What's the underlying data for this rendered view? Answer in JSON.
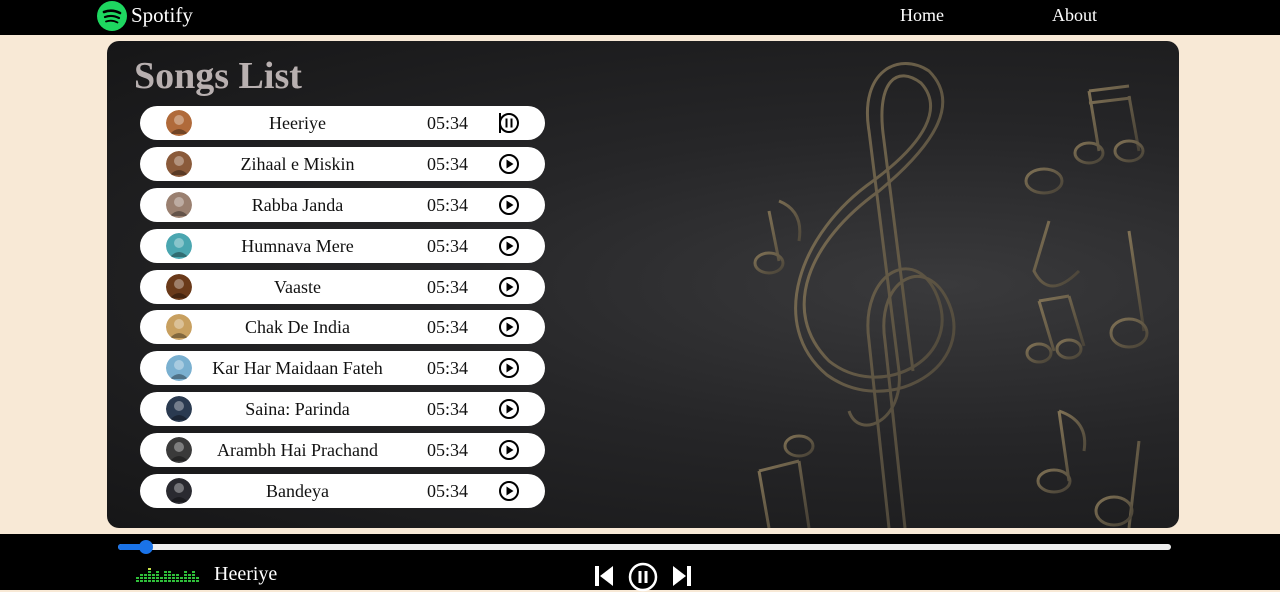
{
  "nav": {
    "brand": "Spotify",
    "links": [
      "Home",
      "About"
    ],
    "brand_color": "#1ed760"
  },
  "main": {
    "title": "Songs List",
    "songs": [
      {
        "name": "Heeriye",
        "duration": "05:34",
        "state": "pause-icon",
        "cover_color": "#b06a3a"
      },
      {
        "name": "Zihaal e Miskin",
        "duration": "05:34",
        "state": "play-icon",
        "cover_color": "#8a5a3a"
      },
      {
        "name": "Rabba Janda",
        "duration": "05:34",
        "state": "play-icon",
        "cover_color": "#9a8070"
      },
      {
        "name": "Humnava Mere",
        "duration": "05:34",
        "state": "play-icon",
        "cover_color": "#4aa6b0"
      },
      {
        "name": "Vaaste",
        "duration": "05:34",
        "state": "play-icon",
        "cover_color": "#6a3a1a"
      },
      {
        "name": "Chak De India",
        "duration": "05:34",
        "state": "play-icon",
        "cover_color": "#c8a060"
      },
      {
        "name": "Kar Har Maidaan Fateh",
        "duration": "05:34",
        "state": "play-icon",
        "cover_color": "#7ab0d0"
      },
      {
        "name": "Saina: Parinda",
        "duration": "05:34",
        "state": "play-icon",
        "cover_color": "#2a3a50"
      },
      {
        "name": "Arambh Hai Prachand",
        "duration": "05:34",
        "state": "play-icon",
        "cover_color": "#3a3a3a"
      },
      {
        "name": "Bandeya",
        "duration": "05:34",
        "state": "play-icon",
        "cover_color": "#2a2a30"
      }
    ]
  },
  "player": {
    "now_playing": "Heeriye",
    "progress": 0.027,
    "accent_color": "#1a73e8",
    "controls": [
      "previous-icon",
      "pause-icon",
      "next-icon"
    ]
  }
}
